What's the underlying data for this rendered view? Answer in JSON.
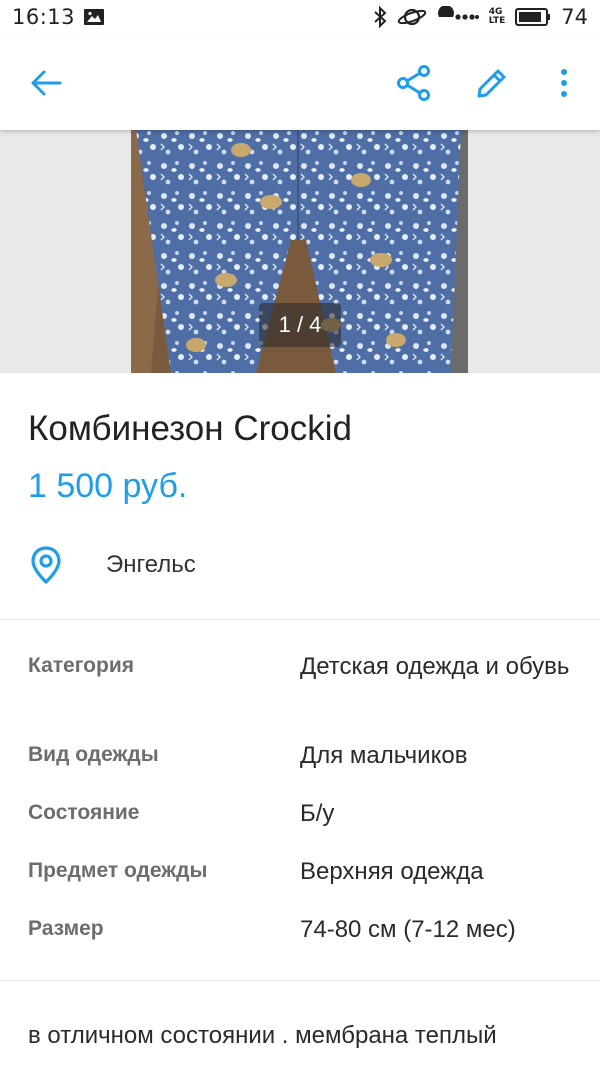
{
  "status_bar": {
    "time": "16:13",
    "battery": "74",
    "network": "4G",
    "network_sub": "LTE"
  },
  "toolbar": {
    "back_icon": "arrow-left-icon",
    "share_icon": "share-icon",
    "edit_icon": "pencil-icon",
    "more_icon": "more-vertical-icon",
    "accent_color": "#1e9ee8"
  },
  "gallery": {
    "counter": "1 / 4"
  },
  "listing": {
    "title": "Комбинезон Crockid",
    "price": "1 500 руб.",
    "location": "Энгельс"
  },
  "params": [
    {
      "label": "Категория",
      "value": "Детская одежда и обувь"
    },
    {
      "label": "Вид одежды",
      "value": "Для мальчиков"
    },
    {
      "label": "Состояние",
      "value": "Б/у"
    },
    {
      "label": "Предмет одежды",
      "value": "Верхняя одежда"
    },
    {
      "label": "Размер",
      "value": "74-80 см (7-12 мес)"
    }
  ],
  "description": "в отличном состоянии . мембрана теплый"
}
